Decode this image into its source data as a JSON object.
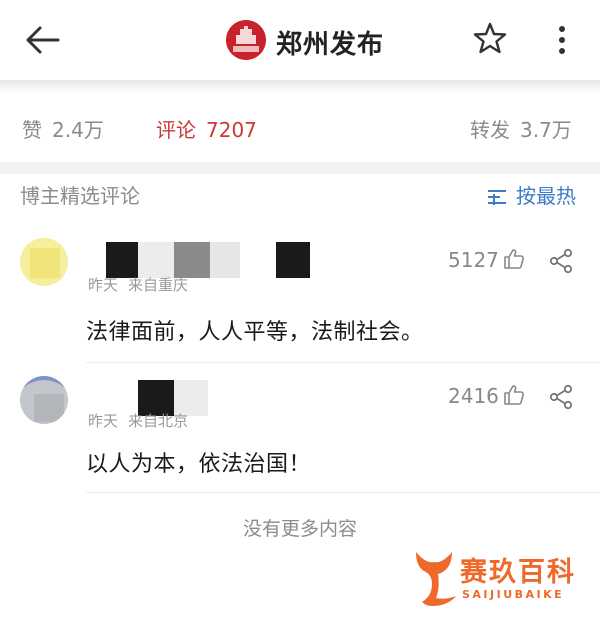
{
  "header": {
    "title": "郑州发布",
    "logo_text": "郑州发布",
    "back_icon": "arrow-left-icon",
    "star_icon": "star-outline-icon",
    "more_icon": "more-vertical-icon"
  },
  "stats": {
    "likes_label": "赞",
    "likes_value": "2.4万",
    "comments_label": "评论",
    "comments_value": "7207",
    "reposts_label": "转发",
    "reposts_value": "3.7万",
    "active_color": "#c83a36"
  },
  "section": {
    "title": "博主精选评论",
    "sort_label": "按最热",
    "sort_icon": "sort-lines-icon",
    "sort_color": "#3d7ac8"
  },
  "comments": [
    {
      "meta_time": "昨天",
      "meta_location": "来自重庆",
      "likes": "5127",
      "text": "法律面前，人人平等，法制社会。"
    },
    {
      "meta_time": "昨天",
      "meta_location": "来自北京",
      "likes": "2416",
      "text": "以人为本，依法治国！"
    }
  ],
  "footer": {
    "no_more": "没有更多内容"
  },
  "watermark": {
    "cn": "赛玖百科",
    "en": "SAIJIUBAIKE",
    "color": "#ef6a2a"
  }
}
